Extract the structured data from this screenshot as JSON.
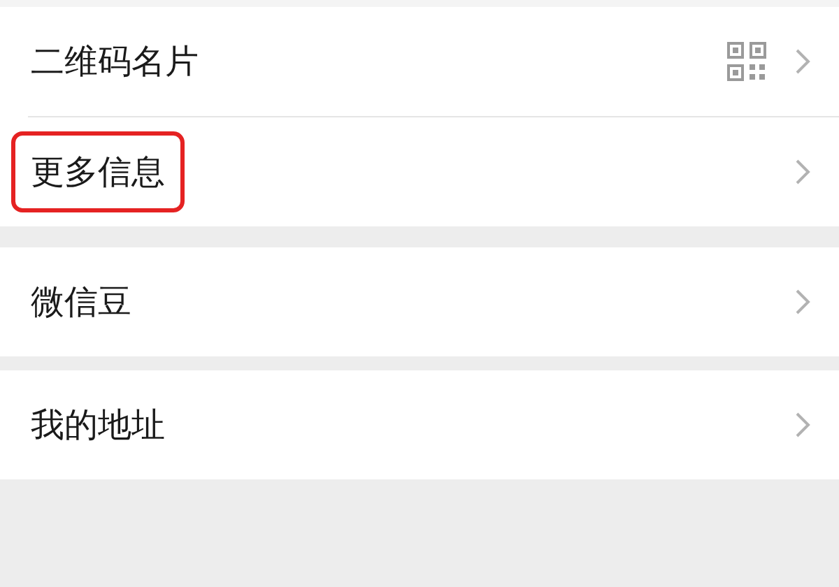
{
  "sections": [
    {
      "items": [
        {
          "label": "二维码名片",
          "kind": "qr",
          "highlighted": false
        },
        {
          "label": "更多信息",
          "kind": "plain",
          "highlighted": true
        }
      ]
    },
    {
      "items": [
        {
          "label": "微信豆",
          "kind": "plain",
          "highlighted": false
        }
      ]
    },
    {
      "items": [
        {
          "label": "我的地址",
          "kind": "plain",
          "highlighted": false
        }
      ]
    }
  ]
}
